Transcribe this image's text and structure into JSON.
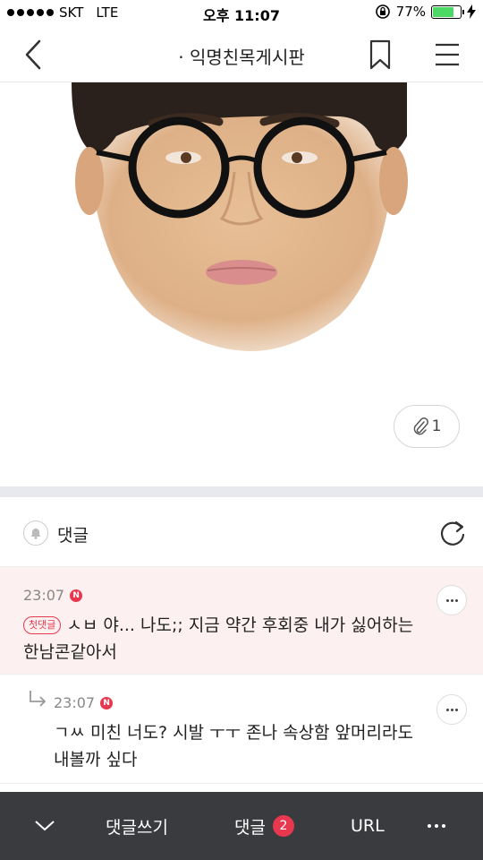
{
  "status_bar": {
    "carrier": "SKT",
    "network": "LTE",
    "time": "오후 11:07",
    "battery": "77%",
    "battery_level": 0.77,
    "icons": [
      "signal-dots-icon",
      "rotation-lock-icon",
      "battery-icon",
      "charging-icon"
    ]
  },
  "header": {
    "title": "· 익명친목게시판",
    "icons": [
      "back-icon",
      "bookmark-icon",
      "menu-icon"
    ]
  },
  "attachment": {
    "count": "1",
    "icon": "paperclip-icon"
  },
  "comments_section": {
    "label": "댓글",
    "icons": [
      "bell-icon",
      "refresh-icon"
    ]
  },
  "comments": [
    {
      "time": "23:07",
      "new_badge": "N",
      "tag": "첫댓글",
      "text": "ㅅㅂ 야... 나도;; 지금 약간 후회중 내가 싫어하는 한남콘같아서",
      "highlight_color": "#fdf0f1"
    },
    {
      "time": "23:07",
      "new_badge": "N",
      "text": "ㄱㅆ 미친 너도? 시발 ㅜㅜ 존나 속상함 앞머리라도 내볼까 싶다",
      "is_reply": true
    }
  ],
  "bottom_bar": {
    "write": "댓글쓰기",
    "comments": "댓글",
    "comment_count": "2",
    "url": "URL",
    "icons": [
      "chevron-down-icon",
      "more-icon"
    ]
  },
  "colors": {
    "accent_red": "#e8384f",
    "bottom_bar": "#3a3b3f",
    "battery_green": "#4cd964"
  }
}
